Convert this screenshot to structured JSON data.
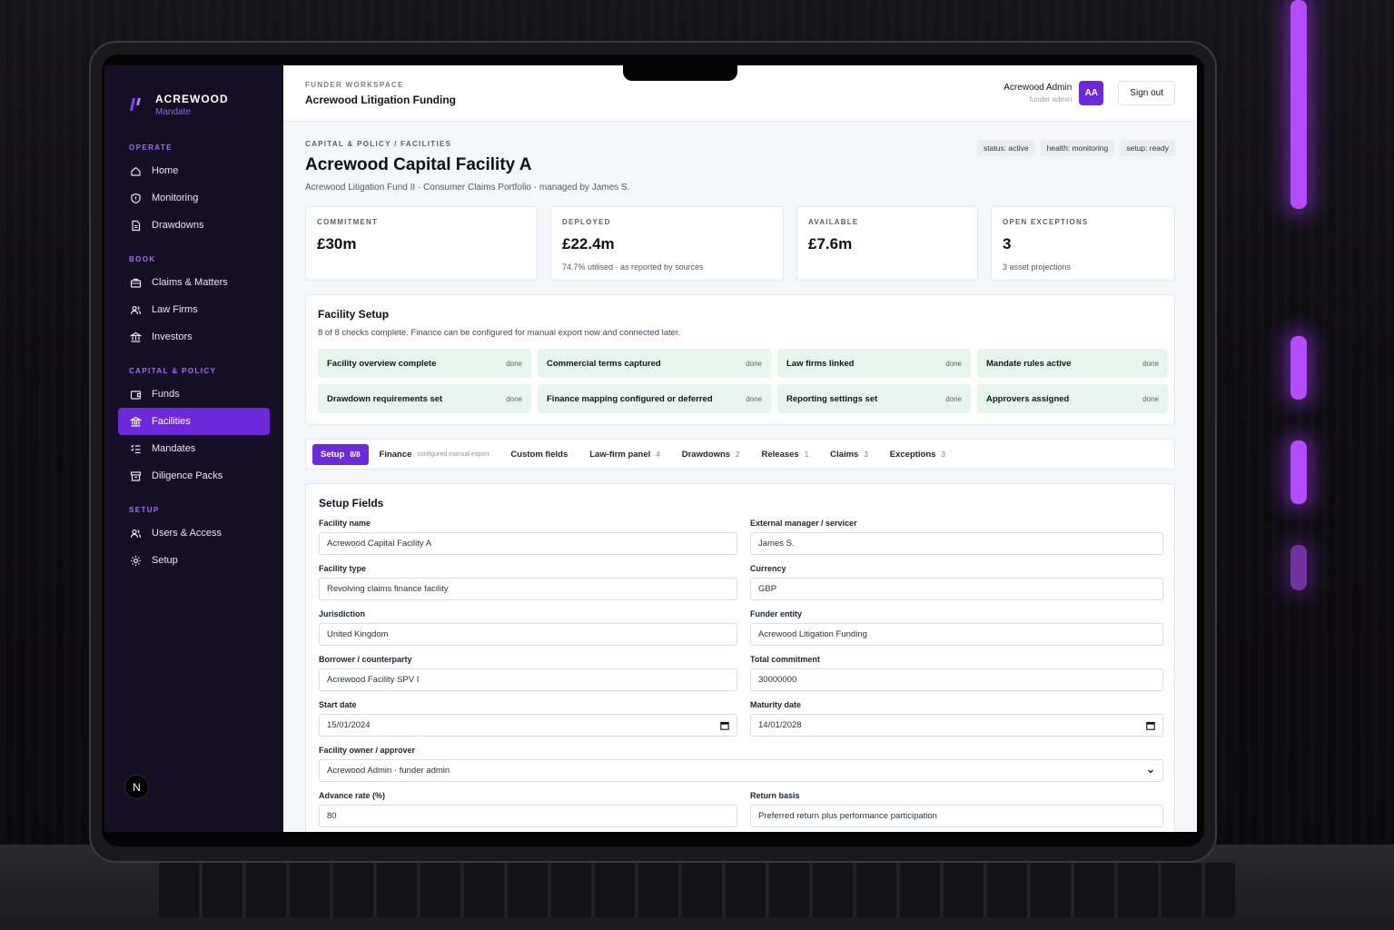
{
  "brand": {
    "name": "ACREWOOD",
    "sub": "Mandate"
  },
  "sidebar": {
    "sections": [
      {
        "label": "OPERATE",
        "items": [
          {
            "label": "Home",
            "icon": "home-icon"
          },
          {
            "label": "Monitoring",
            "icon": "shield-icon"
          },
          {
            "label": "Drawdowns",
            "icon": "document-icon"
          }
        ]
      },
      {
        "label": "BOOK",
        "items": [
          {
            "label": "Claims & Matters",
            "icon": "briefcase-icon"
          },
          {
            "label": "Law Firms",
            "icon": "users-icon"
          },
          {
            "label": "Investors",
            "icon": "bank-icon"
          }
        ]
      },
      {
        "label": "CAPITAL & POLICY",
        "items": [
          {
            "label": "Funds",
            "icon": "wallet-icon"
          },
          {
            "label": "Facilities",
            "icon": "building-icon",
            "active": true
          },
          {
            "label": "Mandates",
            "icon": "list-check-icon"
          },
          {
            "label": "Diligence Packs",
            "icon": "archive-icon"
          }
        ]
      },
      {
        "label": "SETUP",
        "items": [
          {
            "label": "Users & Access",
            "icon": "users-icon"
          },
          {
            "label": "Setup",
            "icon": "gear-icon"
          }
        ]
      }
    ],
    "bottom_badge": "N"
  },
  "topbar": {
    "workspace_label": "FUNDER WORKSPACE",
    "workspace_name": "Acrewood Litigation Funding",
    "user_name": "Acrewood Admin",
    "user_role": "funder admin",
    "avatar": "AA",
    "signout": "Sign out"
  },
  "page": {
    "breadcrumb": "CAPITAL & POLICY / FACILITIES",
    "title": "Acrewood Capital Facility A",
    "subtitle": "Acrewood Litigation Fund II · Consumer Claims Portfolio · managed by James S.",
    "chips": [
      "status: active",
      "health: monitoring",
      "setup: ready"
    ]
  },
  "kpis": [
    {
      "label": "COMMITMENT",
      "value": "£30m",
      "note": ""
    },
    {
      "label": "DEPLOYED",
      "value": "£22.4m",
      "note": "74.7% utilised · as reported by sources"
    },
    {
      "label": "AVAILABLE",
      "value": "£7.6m",
      "note": ""
    },
    {
      "label": "OPEN EXCEPTIONS",
      "value": "3",
      "note": "3 asset projections"
    }
  ],
  "setup": {
    "title": "Facility Setup",
    "desc": "8 of 8 checks complete. Finance can be configured for manual export now and connected later.",
    "checks": [
      {
        "label": "Facility overview complete",
        "status": "done"
      },
      {
        "label": "Commercial terms captured",
        "status": "done"
      },
      {
        "label": "Law firms linked",
        "status": "done"
      },
      {
        "label": "Mandate rules active",
        "status": "done"
      },
      {
        "label": "Drawdown requirements set",
        "status": "done"
      },
      {
        "label": "Finance mapping configured or deferred",
        "status": "done"
      },
      {
        "label": "Reporting settings set",
        "status": "done"
      },
      {
        "label": "Approvers assigned",
        "status": "done"
      }
    ]
  },
  "tabs": [
    {
      "label": "Setup",
      "count": "8/8",
      "sub": "",
      "active": true
    },
    {
      "label": "Finance",
      "count": "",
      "sub": "configured manual export"
    },
    {
      "label": "Custom fields",
      "count": "",
      "sub": ""
    },
    {
      "label": "Law-firm panel",
      "count": "4",
      "sub": ""
    },
    {
      "label": "Drawdowns",
      "count": "2",
      "sub": ""
    },
    {
      "label": "Releases",
      "count": "1",
      "sub": ""
    },
    {
      "label": "Claims",
      "count": "3",
      "sub": ""
    },
    {
      "label": "Exceptions",
      "count": "3",
      "sub": ""
    }
  ],
  "fields": {
    "title": "Setup Fields",
    "items": [
      {
        "label": "Facility name",
        "value": "Acrewood Capital Facility A",
        "kind": "text"
      },
      {
        "label": "External manager / servicer",
        "value": "James S.",
        "kind": "text"
      },
      {
        "label": "Facility type",
        "value": "Revolving claims finance facility",
        "kind": "text"
      },
      {
        "label": "Currency",
        "value": "GBP",
        "kind": "text"
      },
      {
        "label": "Jurisdiction",
        "value": "United Kingdom",
        "kind": "text"
      },
      {
        "label": "Funder entity",
        "value": "Acrewood Litigation Funding",
        "kind": "text"
      },
      {
        "label": "Borrower / counterparty",
        "value": "Acrewood Facility SPV I",
        "kind": "text"
      },
      {
        "label": "Total commitment",
        "value": "30000000",
        "kind": "text"
      },
      {
        "label": "Start date",
        "value": "15/01/2024",
        "kind": "date"
      },
      {
        "label": "Maturity date",
        "value": "14/01/2028",
        "kind": "date"
      },
      {
        "label": "Facility owner / approver",
        "value": "Acrewood Admin · funder admin",
        "kind": "select",
        "full": true
      },
      {
        "label": "Advance rate (%)",
        "value": "80",
        "kind": "text"
      },
      {
        "label": "Return basis",
        "value": "Preferred return plus performance participation",
        "kind": "text"
      }
    ]
  }
}
